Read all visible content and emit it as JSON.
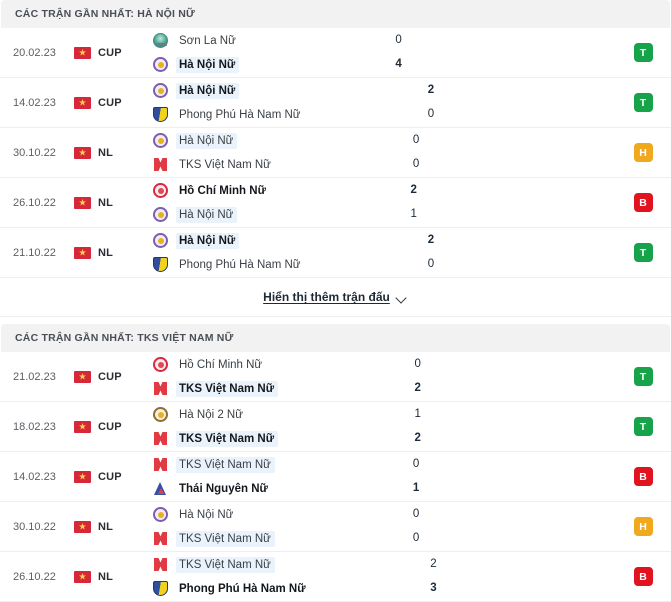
{
  "sections": [
    {
      "header": "CÁC TRẬN GẦN NHẤT: HÀ NỘI NỮ",
      "matches": [
        {
          "date": "20.02.23",
          "competition": "CUP",
          "flag": "vietnam-flag",
          "home": {
            "name": "Sơn La Nữ",
            "crest": "sonla",
            "bold": false,
            "highlight": false
          },
          "away": {
            "name": "Hà Nội Nữ",
            "crest": "hanoi",
            "bold": true,
            "highlight": true
          },
          "home_score": "0",
          "away_score": "4",
          "home_score_bold": false,
          "away_score_bold": true,
          "result": "T",
          "result_type": "win"
        },
        {
          "date": "14.02.23",
          "competition": "CUP",
          "flag": "vietnam-flag",
          "home": {
            "name": "Hà Nội Nữ",
            "crest": "hanoi",
            "bold": true,
            "highlight": true
          },
          "away": {
            "name": "Phong Phú Hà Nam Nữ",
            "crest": "phongphu",
            "bold": false,
            "highlight": false
          },
          "home_score": "2",
          "away_score": "0",
          "home_score_bold": true,
          "away_score_bold": false,
          "result": "T",
          "result_type": "win"
        },
        {
          "date": "30.10.22",
          "competition": "NL",
          "flag": "vietnam-flag",
          "home": {
            "name": "Hà Nội Nữ",
            "crest": "hanoi",
            "bold": false,
            "highlight": true
          },
          "away": {
            "name": "TKS Việt Nam Nữ",
            "crest": "tks",
            "bold": false,
            "highlight": false
          },
          "home_score": "0",
          "away_score": "0",
          "home_score_bold": false,
          "away_score_bold": false,
          "result": "H",
          "result_type": "draw"
        },
        {
          "date": "26.10.22",
          "competition": "NL",
          "flag": "vietnam-flag",
          "home": {
            "name": "Hồ Chí Minh Nữ",
            "crest": "hcm",
            "bold": true,
            "highlight": false
          },
          "away": {
            "name": "Hà Nội Nữ",
            "crest": "hanoi",
            "bold": false,
            "highlight": true
          },
          "home_score": "2",
          "away_score": "1",
          "home_score_bold": true,
          "away_score_bold": false,
          "result": "B",
          "result_type": "loss"
        },
        {
          "date": "21.10.22",
          "competition": "NL",
          "flag": "vietnam-flag",
          "home": {
            "name": "Hà Nội Nữ",
            "crest": "hanoi",
            "bold": true,
            "highlight": true
          },
          "away": {
            "name": "Phong Phú Hà Nam Nữ",
            "crest": "phongphu",
            "bold": false,
            "highlight": false
          },
          "home_score": "2",
          "away_score": "0",
          "home_score_bold": true,
          "away_score_bold": false,
          "result": "T",
          "result_type": "win"
        }
      ],
      "show_more": "Hiển thị thêm trận đấu"
    },
    {
      "header": "CÁC TRẬN GẦN NHẤT: TKS VIỆT NAM NỮ",
      "matches": [
        {
          "date": "21.02.23",
          "competition": "CUP",
          "flag": "vietnam-flag",
          "home": {
            "name": "Hồ Chí Minh Nữ",
            "crest": "hcm",
            "bold": false,
            "highlight": false
          },
          "away": {
            "name": "TKS Việt Nam Nữ",
            "crest": "tks",
            "bold": true,
            "highlight": true
          },
          "home_score": "0",
          "away_score": "2",
          "home_score_bold": false,
          "away_score_bold": true,
          "result": "T",
          "result_type": "win"
        },
        {
          "date": "18.02.23",
          "competition": "CUP",
          "flag": "vietnam-flag",
          "home": {
            "name": "Hà Nội 2 Nữ",
            "crest": "hanoi2",
            "bold": false,
            "highlight": false
          },
          "away": {
            "name": "TKS Việt Nam Nữ",
            "crest": "tks",
            "bold": true,
            "highlight": true
          },
          "home_score": "1",
          "away_score": "2",
          "home_score_bold": false,
          "away_score_bold": true,
          "result": "T",
          "result_type": "win"
        },
        {
          "date": "14.02.23",
          "competition": "CUP",
          "flag": "vietnam-flag",
          "home": {
            "name": "TKS Việt Nam Nữ",
            "crest": "tks",
            "bold": false,
            "highlight": true
          },
          "away": {
            "name": "Thái Nguyên Nữ",
            "crest": "thainguyen",
            "bold": true,
            "highlight": false
          },
          "home_score": "0",
          "away_score": "1",
          "home_score_bold": false,
          "away_score_bold": true,
          "result": "B",
          "result_type": "loss"
        },
        {
          "date": "30.10.22",
          "competition": "NL",
          "flag": "vietnam-flag",
          "home": {
            "name": "Hà Nội Nữ",
            "crest": "hanoi",
            "bold": false,
            "highlight": false
          },
          "away": {
            "name": "TKS Việt Nam Nữ",
            "crest": "tks",
            "bold": false,
            "highlight": true
          },
          "home_score": "0",
          "away_score": "0",
          "home_score_bold": false,
          "away_score_bold": false,
          "result": "H",
          "result_type": "draw"
        },
        {
          "date": "26.10.22",
          "competition": "NL",
          "flag": "vietnam-flag",
          "home": {
            "name": "TKS Việt Nam Nữ",
            "crest": "tks",
            "bold": false,
            "highlight": true
          },
          "away": {
            "name": "Phong Phú Hà Nam Nữ",
            "crest": "phongphu",
            "bold": true,
            "highlight": false
          },
          "home_score": "2",
          "away_score": "3",
          "home_score_bold": false,
          "away_score_bold": true,
          "result": "B",
          "result_type": "loss"
        }
      ],
      "show_more": null
    }
  ],
  "colors": {
    "win": "#16a34a",
    "draw": "#f0a81d",
    "loss": "#e0131e",
    "header_bg": "#f2f2f2",
    "highlight_bg": "#eaf2fb"
  }
}
